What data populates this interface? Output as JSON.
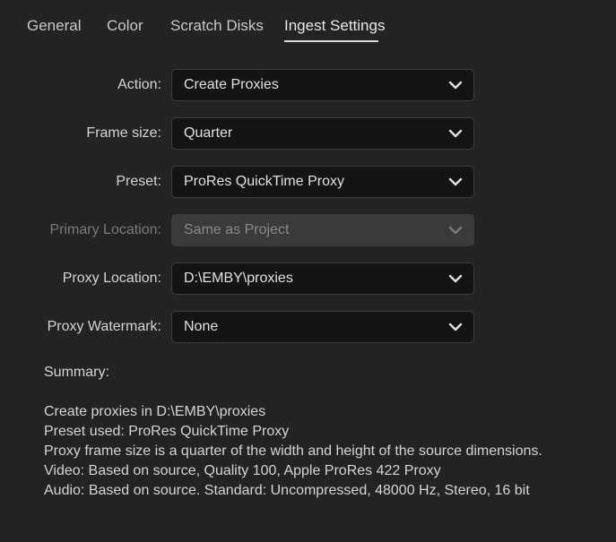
{
  "tabs": [
    {
      "label": "General"
    },
    {
      "label": "Color"
    },
    {
      "label": "Scratch Disks"
    },
    {
      "label": "Ingest Settings"
    }
  ],
  "active_tab": "Ingest Settings",
  "fields": {
    "action": {
      "label": "Action:",
      "value": "Create Proxies",
      "enabled": true
    },
    "frame_size": {
      "label": "Frame size:",
      "value": "Quarter",
      "enabled": true
    },
    "preset": {
      "label": "Preset:",
      "value": "ProRes QuickTime Proxy",
      "enabled": true
    },
    "primary_location": {
      "label": "Primary Location:",
      "value": "Same as Project",
      "enabled": false
    },
    "proxy_location": {
      "label": "Proxy Location:",
      "value": "D:\\EMBY\\proxies",
      "enabled": true
    },
    "proxy_watermark": {
      "label": "Proxy Watermark:",
      "value": "None",
      "enabled": true
    }
  },
  "summary": {
    "heading": "Summary:",
    "lines": [
      "Create proxies in D:\\EMBY\\proxies",
      "Preset used: ProRes QuickTime Proxy",
      "Proxy frame size is a quarter of the width and height of the source dimensions.",
      "Video: Based on source, Quality 100, Apple ProRes 422 Proxy",
      "Audio: Based on source. Standard: Uncompressed, 48000 Hz, Stereo, 16 bit"
    ]
  },
  "icons": {
    "dropdown": "chevron-down-icon"
  },
  "colors": {
    "background": "#232323",
    "field_background": "#141414",
    "field_disabled": "#3a3a3a",
    "text": "#d4d4d4",
    "text_disabled": "#7a7a7a",
    "active_tab_underline": "#d8d8d8"
  }
}
